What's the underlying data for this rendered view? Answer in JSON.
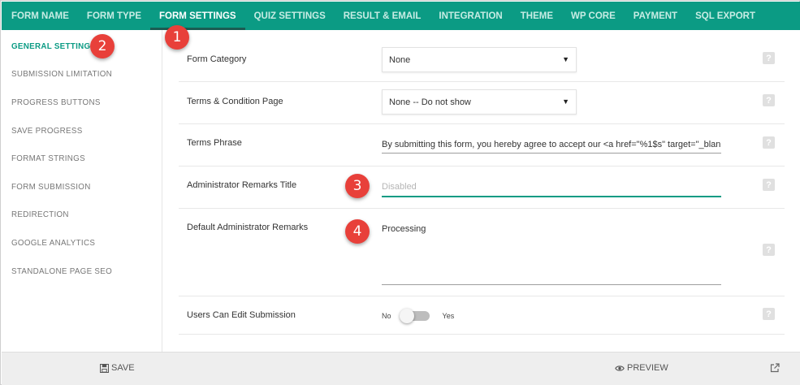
{
  "tabs": [
    {
      "label": "FORM NAME",
      "active": false
    },
    {
      "label": "FORM TYPE",
      "active": false
    },
    {
      "label": "FORM SETTINGS",
      "active": true
    },
    {
      "label": "QUIZ SETTINGS",
      "active": false
    },
    {
      "label": "RESULT & EMAIL",
      "active": false
    },
    {
      "label": "INTEGRATION",
      "active": false
    },
    {
      "label": "THEME",
      "active": false
    },
    {
      "label": "WP CORE",
      "active": false
    },
    {
      "label": "PAYMENT",
      "active": false
    },
    {
      "label": "SQL EXPORT",
      "active": false
    }
  ],
  "sidebar": {
    "items": [
      {
        "label": "GENERAL SETTINGS",
        "active": true
      },
      {
        "label": "SUBMISSION LIMITATION",
        "active": false
      },
      {
        "label": "PROGRESS BUTTONS",
        "active": false
      },
      {
        "label": "SAVE PROGRESS",
        "active": false
      },
      {
        "label": "FORMAT STRINGS",
        "active": false
      },
      {
        "label": "FORM SUBMISSION",
        "active": false
      },
      {
        "label": "REDIRECTION",
        "active": false
      },
      {
        "label": "GOOGLE ANALYTICS",
        "active": false
      },
      {
        "label": "STANDALONE PAGE SEO",
        "active": false
      }
    ]
  },
  "fields": {
    "form_category": {
      "label": "Form Category",
      "value": "None"
    },
    "terms_page": {
      "label": "Terms & Condition Page",
      "value": "None -- Do not show"
    },
    "terms_phrase": {
      "label": "Terms Phrase",
      "value": "By submitting this form, you hereby agree to accept our <a href=\"%1$s\" target=\"_blan"
    },
    "admin_remarks_title": {
      "label": "Administrator Remarks Title",
      "placeholder": "Disabled",
      "value": ""
    },
    "default_admin_remarks": {
      "label": "Default Administrator Remarks",
      "value": "Processing"
    },
    "users_can_edit": {
      "label": "Users Can Edit Submission",
      "off_label": "No",
      "on_label": "Yes",
      "checked": false
    }
  },
  "help_glyph": "?",
  "footer": {
    "save_label": "SAVE",
    "preview_label": "PREVIEW"
  },
  "annotations": [
    "1",
    "2",
    "3",
    "4"
  ],
  "colors": {
    "accent": "#0b9b84",
    "badge": "#e8403a"
  },
  "icons": {
    "save": "floppy-disk-icon",
    "preview": "eye-icon",
    "external": "external-link-icon",
    "caret": "caret-down-icon",
    "help": "question-mark-icon"
  }
}
